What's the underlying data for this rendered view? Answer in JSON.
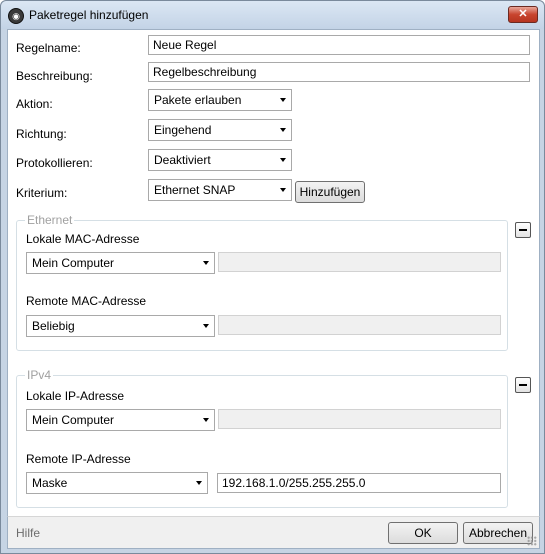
{
  "window": {
    "title": "Paketregel hinzufügen",
    "close_symbol": "✕"
  },
  "form": {
    "name_label": "Regelname:",
    "name_value": "Neue Regel",
    "description_label": "Beschreibung:",
    "description_value": "Regelbeschreibung",
    "action_label": "Aktion:",
    "action_value": "Pakete erlauben",
    "direction_label": "Richtung:",
    "direction_value": "Eingehend",
    "logging_label": "Protokollieren:",
    "logging_value": "Deaktiviert",
    "criterion_label": "Kriterium:",
    "criterion_value": "Ethernet SNAP",
    "add_button": "Hinzufügen"
  },
  "ethernet": {
    "title": "Ethernet",
    "local_label": "Lokale MAC-Adresse",
    "local_value": "Mein Computer",
    "local_extra": "",
    "remote_label": "Remote MAC-Adresse",
    "remote_value": "Beliebig",
    "remote_extra": ""
  },
  "ipv4": {
    "title": "IPv4",
    "local_label": "Lokale IP-Adresse",
    "local_value": "Mein Computer",
    "local_extra": "",
    "remote_label": "Remote IP-Adresse",
    "remote_value": "Maske",
    "remote_extra": "192.168.1.0/255.255.255.0"
  },
  "footer": {
    "help": "Hilfe",
    "ok": "OK",
    "cancel": "Abbrechen"
  },
  "icons": {
    "app": "app-icon",
    "close": "close-icon",
    "collapse": "minus-icon",
    "dropdown": "chevron-down-icon"
  },
  "colors": {
    "titlebar": "#c6d4e4",
    "close_button": "#c8442e",
    "group_title": "#a0a0a0"
  }
}
